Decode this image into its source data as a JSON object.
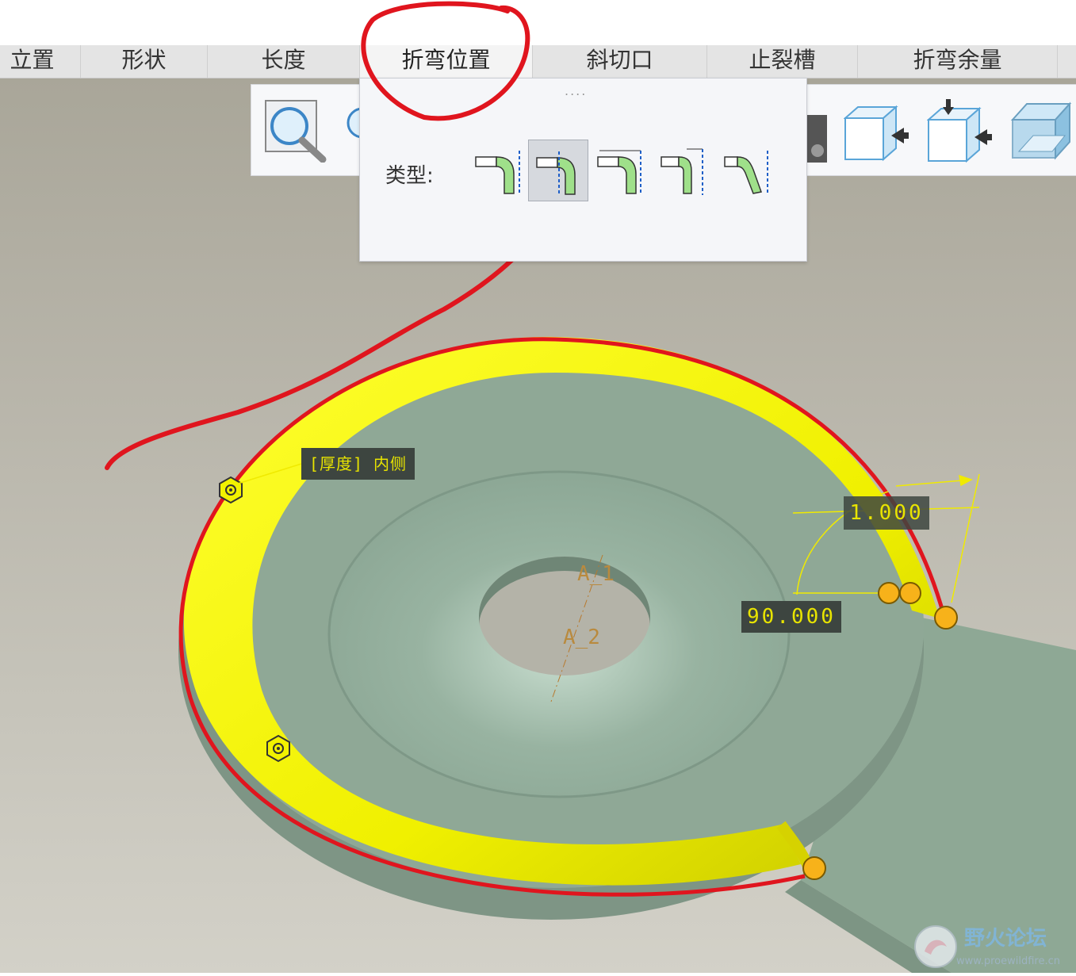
{
  "tabs": [
    {
      "label": "位置",
      "shown": "立置"
    },
    {
      "label": "形状"
    },
    {
      "label": "长度"
    },
    {
      "label": "折弯位置"
    },
    {
      "label": "斜切口"
    },
    {
      "label": "止裂槽"
    },
    {
      "label": "折弯余量"
    }
  ],
  "active_tab": "折弯位置",
  "popup": {
    "grip": "....",
    "type_label": "类型:",
    "type_options": [
      {
        "icon": "bend-type-1-icon"
      },
      {
        "icon": "bend-type-2-icon",
        "selected": true
      },
      {
        "icon": "bend-type-3-icon"
      },
      {
        "icon": "bend-type-4-icon"
      },
      {
        "icon": "bend-type-5-icon"
      }
    ]
  },
  "toolbar": {
    "icons": [
      "zoom-icon",
      "reorient-icon",
      "camera-icon",
      "view-box-right-icon",
      "view-box-top-right-icon",
      "view-box-transparent-icon"
    ]
  },
  "model": {
    "thickness_label": "[厚度] 内侧",
    "length_dim": "1.000",
    "angle_dim": "90.000",
    "axis_1": "A_1",
    "axis_2": "A_2"
  },
  "watermark": {
    "title": "野火论坛",
    "url": "www.proewildfire.cn"
  },
  "colors": {
    "flange": "#f2f200",
    "plate": "#8fa896",
    "annotation": "#e0151e",
    "dim_text": "#e8e400",
    "handle": "#f7b21a"
  }
}
